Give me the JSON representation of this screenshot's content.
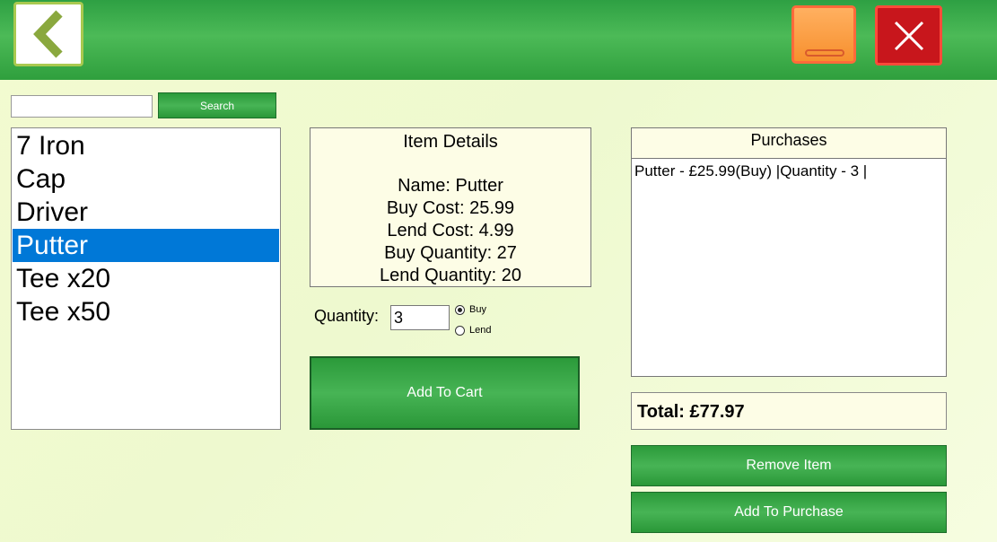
{
  "header": {
    "back_icon": "chevron-left-icon",
    "minimize_icon": "minimize-icon",
    "close_icon": "close-icon"
  },
  "search": {
    "value": "",
    "placeholder": "",
    "button_label": "Search"
  },
  "items": [
    {
      "label": "7 Iron",
      "selected": false
    },
    {
      "label": "Cap",
      "selected": false
    },
    {
      "label": "Driver",
      "selected": false
    },
    {
      "label": "Putter",
      "selected": true
    },
    {
      "label": "Tee x20",
      "selected": false
    },
    {
      "label": "Tee x50",
      "selected": false
    }
  ],
  "details": {
    "title": "Item Details",
    "name": "Name: Putter",
    "buy_cost": "Buy Cost: 25.99",
    "lend_cost": "Lend Cost: 4.99",
    "buy_quantity": "Buy Quantity: 27",
    "lend_quantity": "Lend Quantity: 20"
  },
  "quantity": {
    "label": "Quantity:",
    "value": "3",
    "buy_label": "Buy",
    "lend_label": "Lend",
    "selected_mode": "Buy"
  },
  "add_to_cart_label": "Add To Cart",
  "purchases": {
    "title": "Purchases",
    "entries": [
      "Putter - £25.99(Buy) |Quantity - 3 |"
    ],
    "total": "Total: £77.97"
  },
  "buttons": {
    "remove_item": "Remove Item",
    "add_to_purchase": "Add To Purchase"
  },
  "colors": {
    "header_green": "#3aad4a",
    "selection_blue": "#0078d7",
    "close_red": "#c8161c",
    "minimize_orange": "#f7902e"
  }
}
